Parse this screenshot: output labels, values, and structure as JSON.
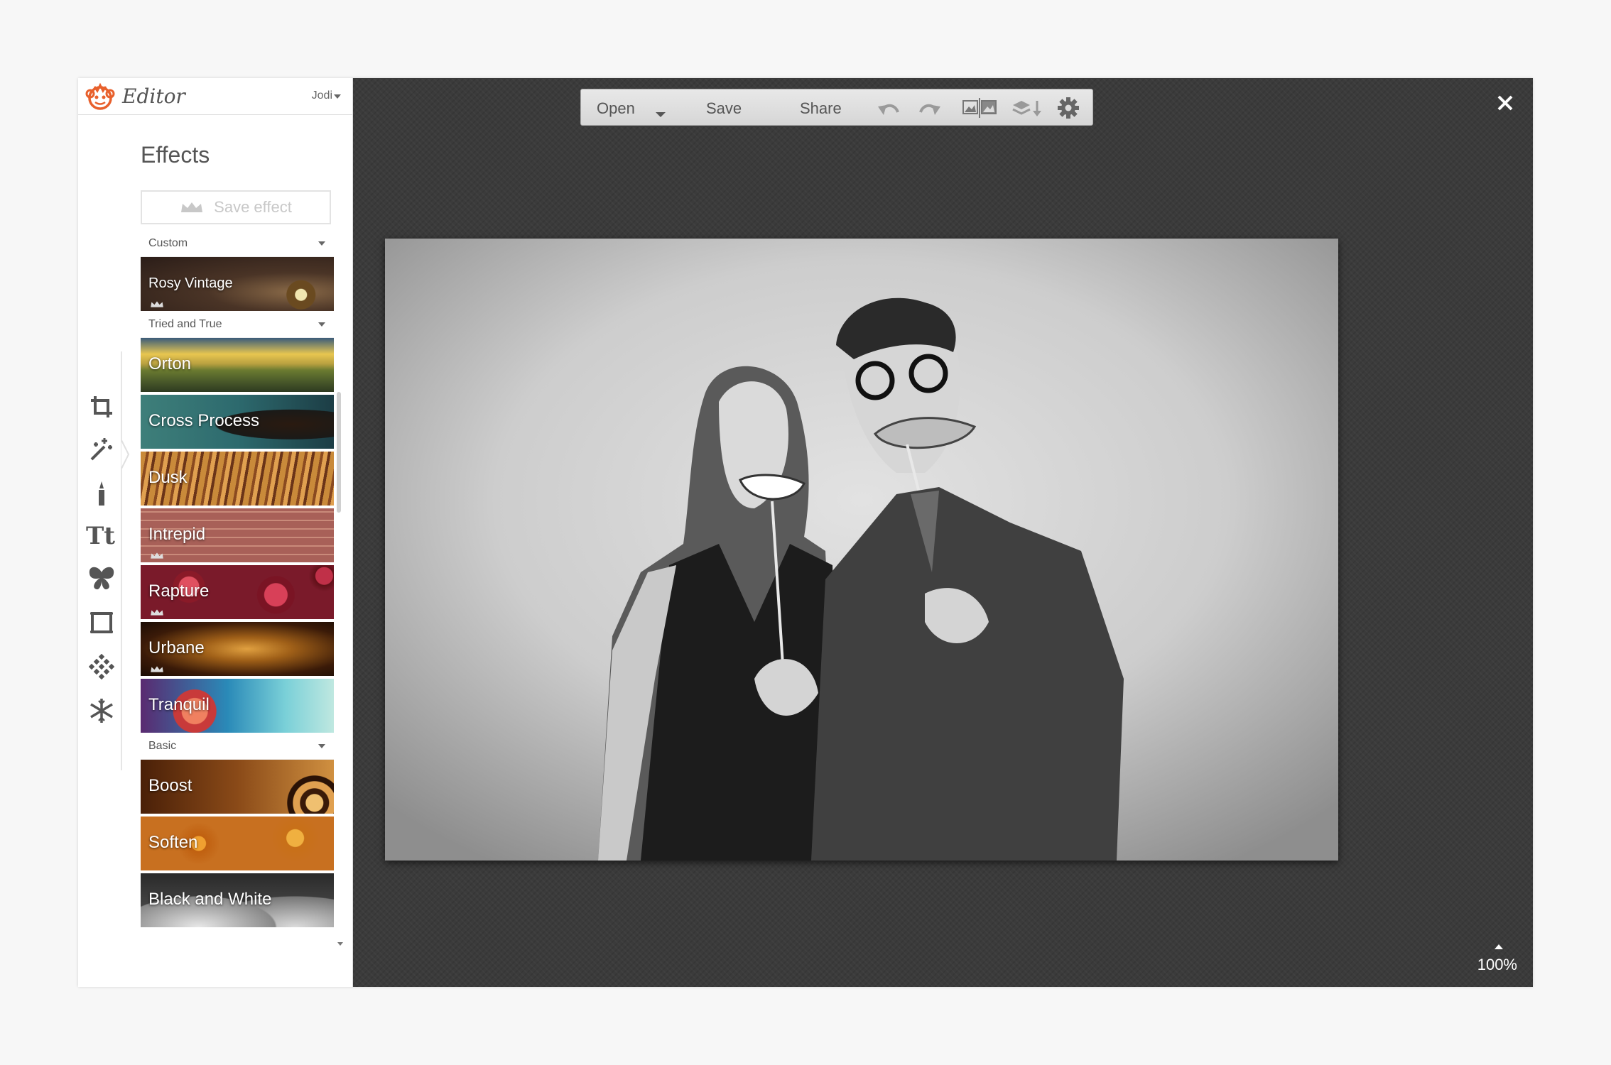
{
  "brand": {
    "name": "Editor",
    "user": "Jodi"
  },
  "panel": {
    "title": "Effects",
    "save_effect_label": "Save effect",
    "sections": [
      {
        "label": "Custom"
      },
      {
        "label": "Tried and True"
      },
      {
        "label": "Basic"
      }
    ],
    "custom_effects": [
      {
        "label": "Rosy Vintage",
        "premium": true
      }
    ],
    "tried_and_true_effects": [
      {
        "label": "Orton",
        "premium": false
      },
      {
        "label": "Cross Process",
        "premium": false
      },
      {
        "label": "Dusk",
        "premium": false
      },
      {
        "label": "Intrepid",
        "premium": true
      },
      {
        "label": "Rapture",
        "premium": true
      },
      {
        "label": "Urbane",
        "premium": true
      },
      {
        "label": "Tranquil",
        "premium": false
      }
    ],
    "basic_effects": [
      {
        "label": "Boost",
        "premium": false
      },
      {
        "label": "Soften",
        "premium": false
      },
      {
        "label": "Black and White",
        "premium": false
      }
    ],
    "tools": [
      "crop-icon",
      "magic-wand-icon",
      "touch-up-brush-icon",
      "text-icon",
      "butterfly-overlay-icon",
      "frame-icon",
      "texture-icon",
      "seasonal-snowflake-icon"
    ]
  },
  "toolbar": {
    "open_label": "Open",
    "save_label": "Save",
    "share_label": "Share",
    "icons": [
      "undo-icon",
      "redo-icon",
      "compare-images-icon",
      "layers-download-icon",
      "settings-gear-icon"
    ]
  },
  "canvas": {
    "photo_description_icon": "photo-couple-with-mustache-props",
    "zoom": "100%"
  },
  "colors": {
    "brand_accent": "#e8602c",
    "stage_bg": "#3b3b3b",
    "panel_bg": "#ffffff"
  }
}
